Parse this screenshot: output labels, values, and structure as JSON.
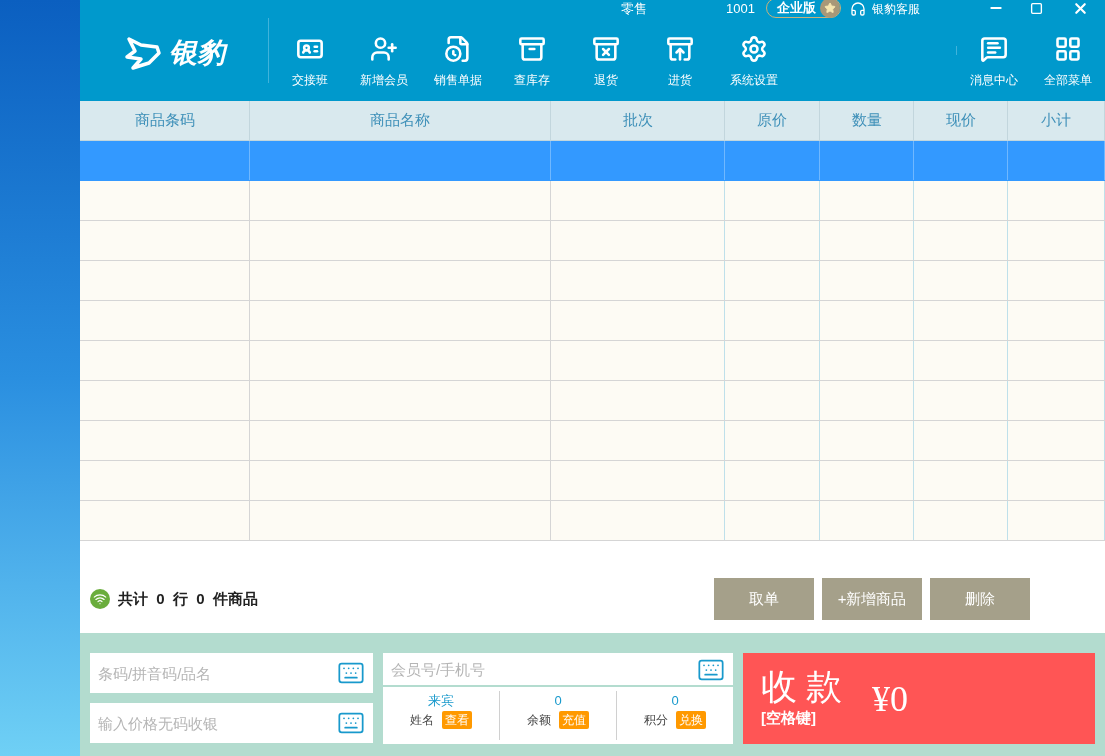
{
  "title_bar": {
    "mode": "零售",
    "user_id": "1001",
    "edition": "企业版",
    "support": "银豹客服"
  },
  "logo": {
    "text": "银豹"
  },
  "toolbar": [
    {
      "label": "交接班",
      "kind": "shift"
    },
    {
      "label": "新增会员",
      "kind": "member"
    },
    {
      "label": "销售单据",
      "kind": "receipt"
    },
    {
      "label": "查库存",
      "kind": "stock"
    },
    {
      "label": "退货",
      "kind": "return"
    },
    {
      "label": "进货",
      "kind": "purchase"
    },
    {
      "label": "系统设置",
      "kind": "settings"
    }
  ],
  "toolbar_right": [
    {
      "label": "消息中心",
      "kind": "message"
    },
    {
      "label": "全部菜单",
      "kind": "menu"
    }
  ],
  "table": {
    "columns": [
      "商品条码",
      "商品名称",
      "批次",
      "原价",
      "数量",
      "现价",
      "小计"
    ],
    "rows": [
      {
        "selected": true
      },
      {
        "selected": false
      },
      {
        "selected": false
      },
      {
        "selected": false
      },
      {
        "selected": false
      },
      {
        "selected": false
      },
      {
        "selected": false
      },
      {
        "selected": false
      },
      {
        "selected": false
      },
      {
        "selected": false
      }
    ]
  },
  "summary": {
    "prefix": "共计",
    "rows": "0",
    "middle": "行",
    "items": "0",
    "suffix": "件商品"
  },
  "actions": [
    "取单",
    "+新增商品",
    "删除"
  ],
  "barcode_field": {
    "placeholder": "条码/拼音码/品名"
  },
  "price_field": {
    "placeholder": "输入价格无码收银"
  },
  "member": {
    "placeholder": "会员号/手机号",
    "stats": [
      {
        "value": "来宾",
        "label": "姓名",
        "button": "查看"
      },
      {
        "value": "0",
        "label": "余额",
        "button": "充值"
      },
      {
        "value": "0",
        "label": "积分",
        "button": "兑换"
      }
    ]
  },
  "checkout": {
    "title": "收 款",
    "hint": "[空格键]",
    "amount": "¥0"
  }
}
